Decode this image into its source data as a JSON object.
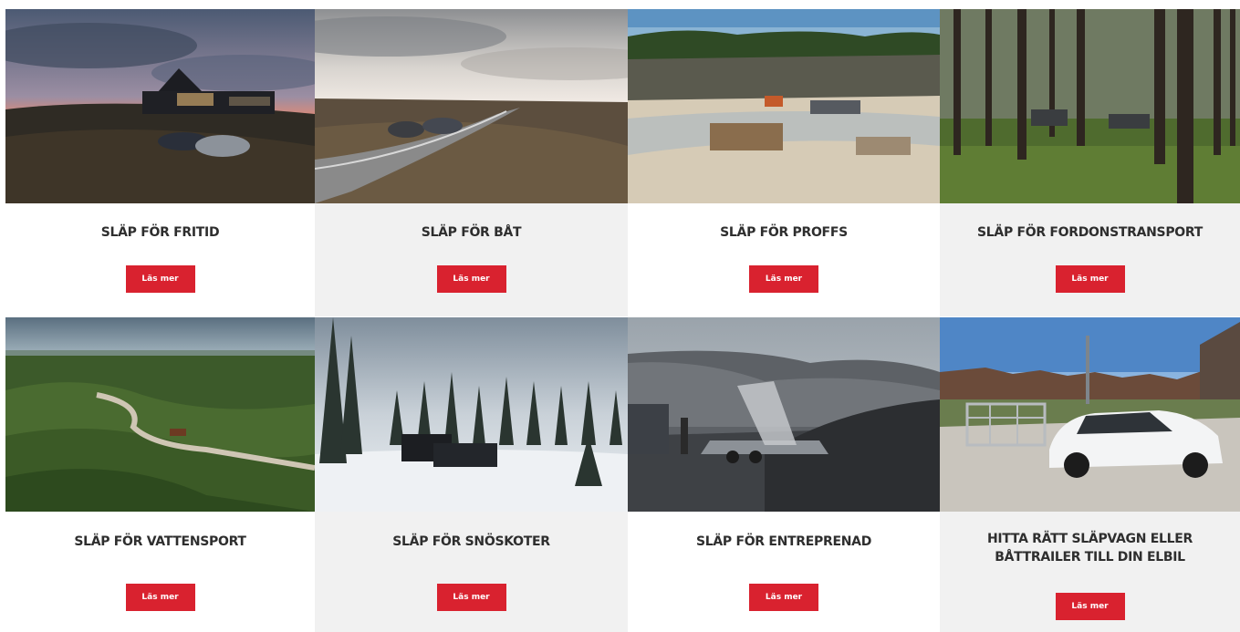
{
  "cards": [
    {
      "title": "SLÄP FÖR FRITID",
      "button": "Läs mer"
    },
    {
      "title": "SLÄP FÖR BÅT",
      "button": "Läs mer"
    },
    {
      "title": "SLÄP FÖR PROFFS",
      "button": "Läs mer"
    },
    {
      "title": "SLÄP FÖR FORDONSTRANSPORT",
      "button": "Läs mer"
    },
    {
      "title": "SLÄP FÖR VATTENSPORT",
      "button": "Läs mer"
    },
    {
      "title": "SLÄP FÖR SNÖSKOTER",
      "button": "Läs mer"
    },
    {
      "title": "SLÄP FÖR ENTREPRENAD",
      "button": "Läs mer"
    },
    {
      "title": "HITTA RÄTT SLÄPVAGN ELLER BÅTTRAILER TILL DIN ELBIL",
      "button": "Läs mer"
    }
  ],
  "colors": {
    "button": "#d9222f",
    "title": "#2e2e2e",
    "alt_bg": "#f1f1f1"
  }
}
